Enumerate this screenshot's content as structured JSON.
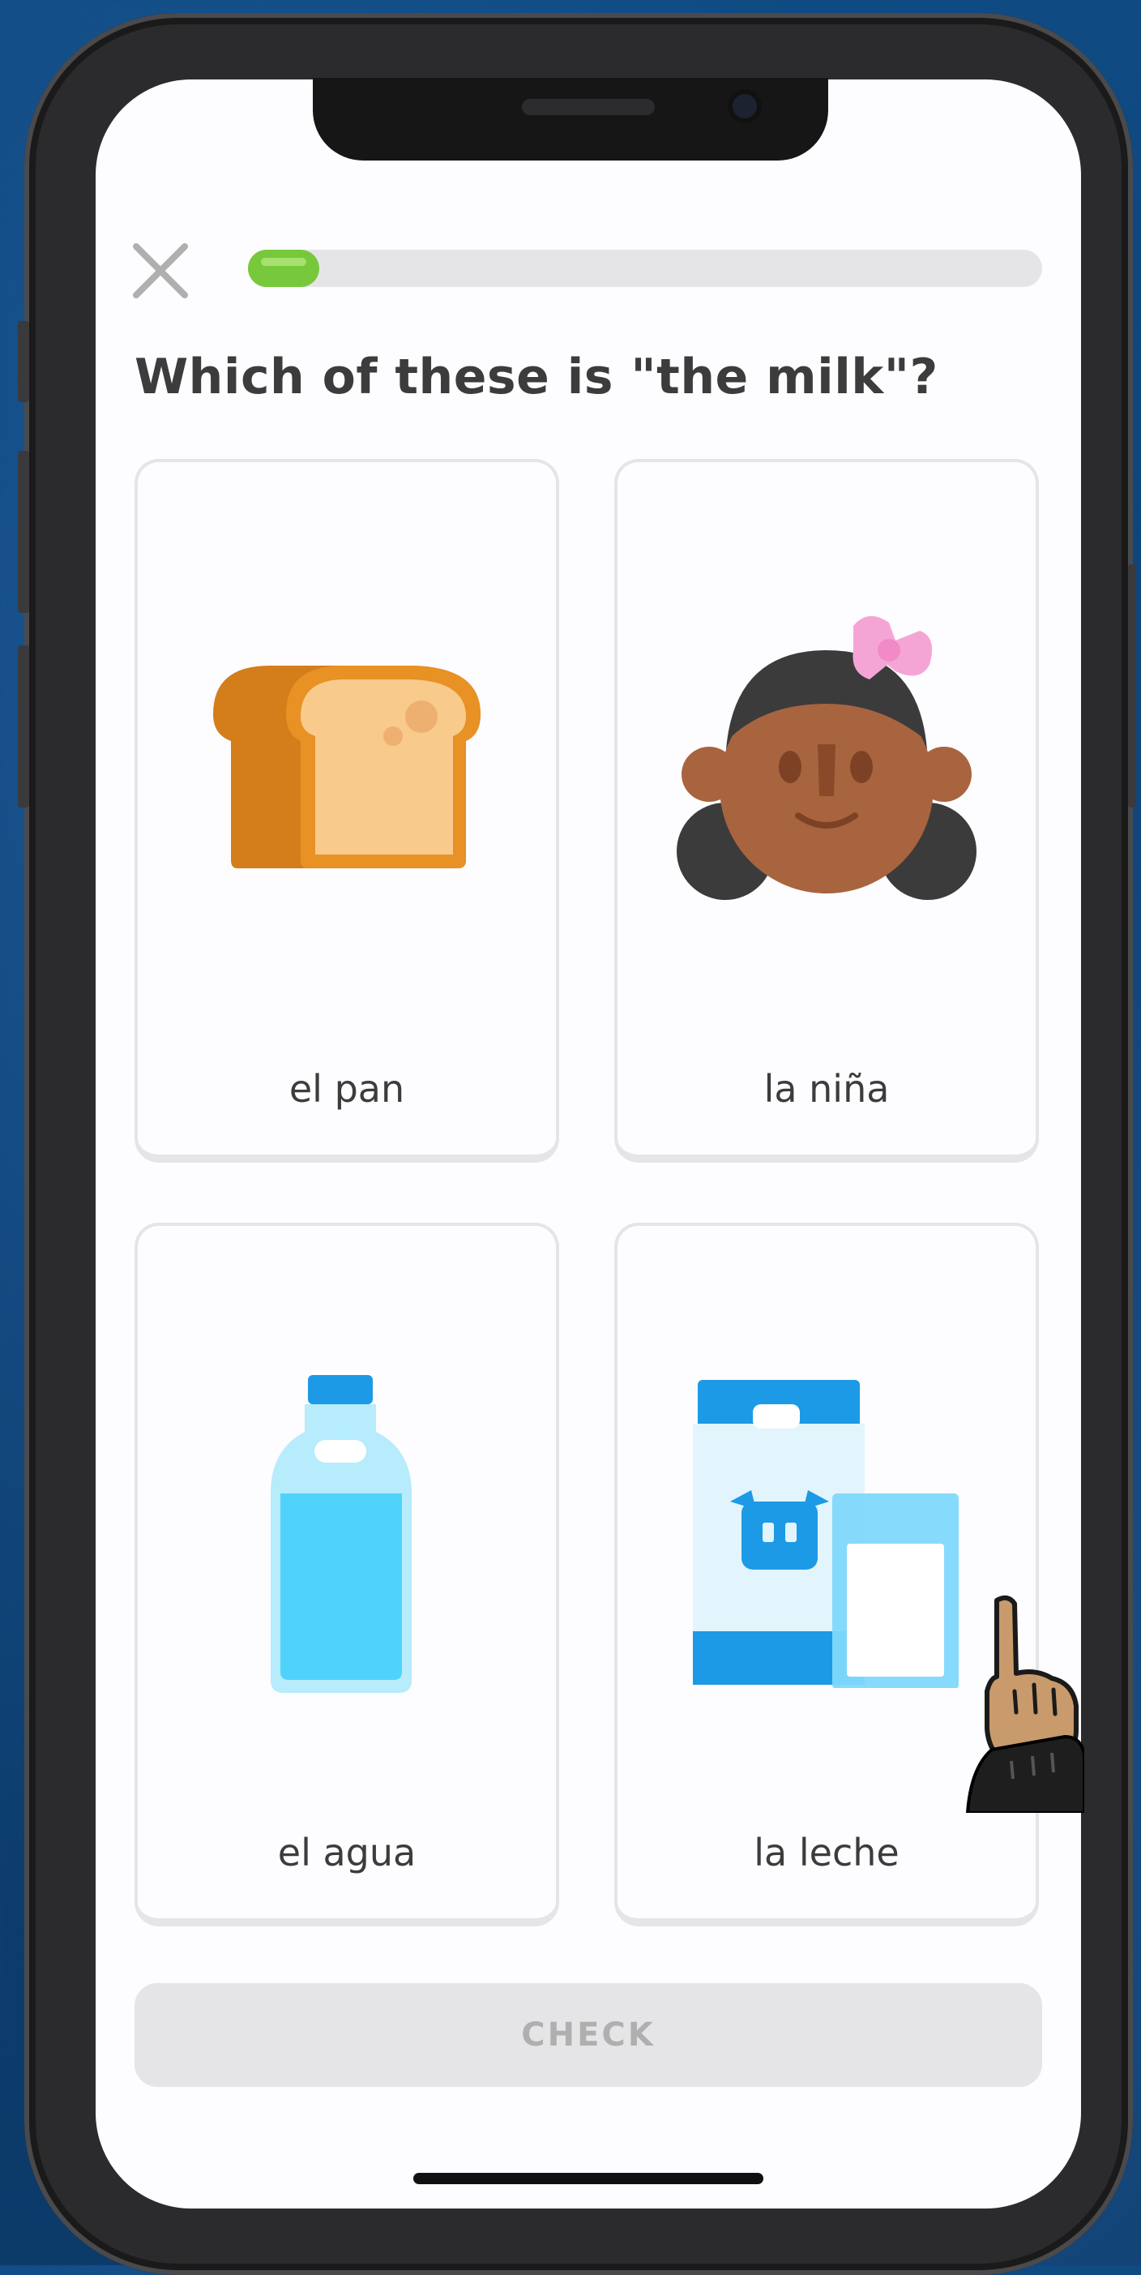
{
  "lesson": {
    "question": "Which of these is \"the milk\"?",
    "progress": 0.09,
    "close_icon": "close-icon",
    "accent_color": "#78c83c"
  },
  "options": [
    {
      "label": "el pan",
      "icon": "bread-icon"
    },
    {
      "label": "la niña",
      "icon": "girl-icon"
    },
    {
      "label": "el agua",
      "icon": "water-bottle-icon"
    },
    {
      "label": "la leche",
      "icon": "milk-carton-icon"
    }
  ],
  "check_button": {
    "label": "CHECK",
    "enabled": false
  },
  "pointer_icon": "hand-pointer-icon"
}
